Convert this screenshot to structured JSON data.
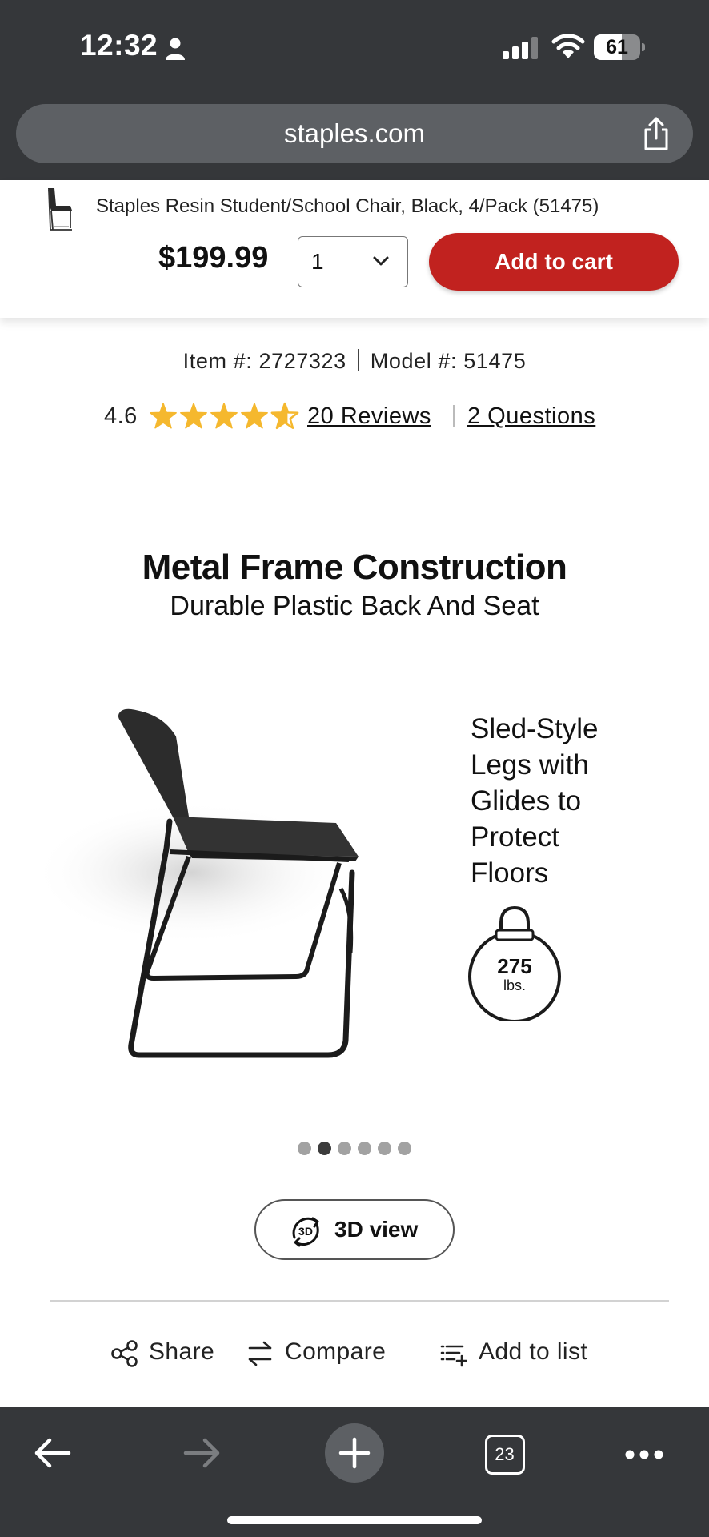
{
  "status_bar": {
    "time": "12:32",
    "battery": "61",
    "battery_percent": 61
  },
  "browser": {
    "url": "staples.com",
    "tab_count": "23"
  },
  "sticky_header": {
    "product_title": "Staples Resin Student/School Chair, Black, 4/Pack (51475)",
    "price": "$199.99",
    "quantity": "1",
    "add_to_cart_label": "Add to cart"
  },
  "product": {
    "item_text": "Item #: 2727323",
    "model_text": "Model #: 51475",
    "rating": "4.6",
    "rating_value": 4.6,
    "reviews_label": "20 Reviews",
    "questions_label": "2 Questions"
  },
  "image": {
    "headline": "Metal Frame Construction",
    "subhead": "Durable Plastic Back And Seat",
    "side_lines": [
      "Sled-Style",
      "Legs with",
      "Glides to",
      "Protect",
      "Floors"
    ],
    "weight_value": "275",
    "weight_unit": "lbs."
  },
  "carousel": {
    "count": 6,
    "active_index": 1
  },
  "view3d": {
    "icon_text": "3D",
    "label": "3D view"
  },
  "actions": {
    "share": "Share",
    "compare": "Compare",
    "add_to_list": "Add to list"
  },
  "colors": {
    "chrome": "#35373a",
    "url_bar": "#5d6064",
    "cart_red": "#c1221f",
    "star": "#f5b82e"
  },
  "icons": {
    "status": [
      "person-icon",
      "cellular-signal-icon",
      "wifi-icon",
      "battery-icon"
    ],
    "url_bar": "share-icon",
    "actions": [
      "share-icon",
      "compare-arrows-icon",
      "add-to-list-icon"
    ],
    "toolbar": [
      "back-arrow-icon",
      "forward-arrow-icon",
      "plus-icon",
      "tabs-icon",
      "more-icon"
    ]
  }
}
